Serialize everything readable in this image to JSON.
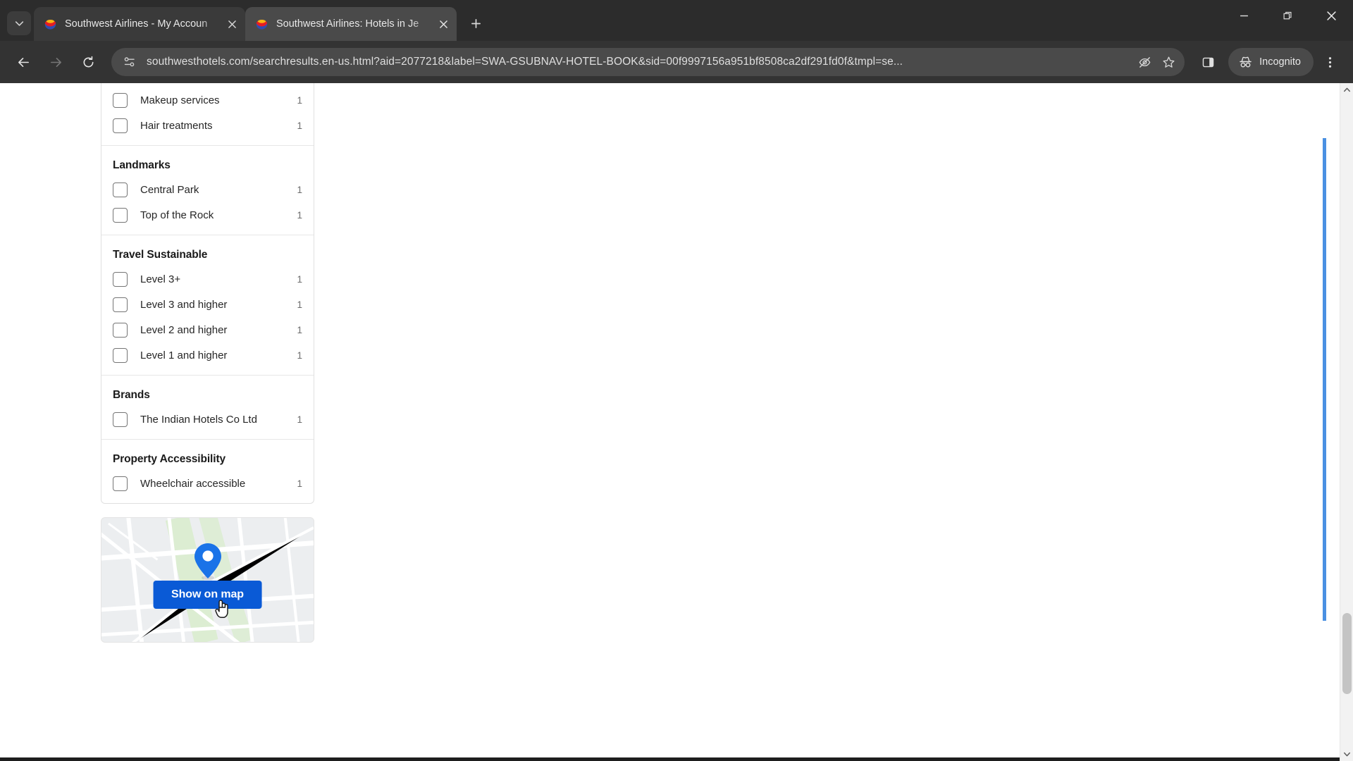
{
  "browser": {
    "tabs": [
      {
        "title": "Southwest Airlines - My Accoun",
        "active": false
      },
      {
        "title": "Southwest Airlines: Hotels in Je",
        "active": true
      }
    ],
    "new_tab_label": "+",
    "omnibox": {
      "url": "southwesthotels.com/searchresults.en-us.html?aid=2077218&label=SWA-GSUBNAV-HOTEL-BOOK&sid=00f9997156a951bf8508ca2df291fd0f&tmpl=se...",
      "site_icon": "page-info-icon",
      "tracking_protection_icon": "eye-off-icon",
      "bookmark_icon": "star-icon"
    },
    "profile": {
      "label": "Incognito",
      "icon": "incognito-icon"
    },
    "nav": {
      "back": "back-arrow-icon",
      "forward": "forward-arrow-icon",
      "reload": "reload-icon"
    },
    "side_panel_icon": "side-panel-icon",
    "menu_icon": "three-dot-menu-icon",
    "window_controls": {
      "minimize": "minimize-icon",
      "maximize": "restore-icon",
      "close": "close-icon"
    }
  },
  "sidebar": {
    "groups": [
      {
        "title": "",
        "items": [
          {
            "label": "Makeup services",
            "count": "1"
          },
          {
            "label": "Hair treatments",
            "count": "1"
          }
        ]
      },
      {
        "title": "Landmarks",
        "items": [
          {
            "label": "Central Park",
            "count": "1"
          },
          {
            "label": "Top of the Rock",
            "count": "1"
          }
        ]
      },
      {
        "title": "Travel Sustainable",
        "items": [
          {
            "label": "Level 3+",
            "count": "1"
          },
          {
            "label": "Level 3 and higher",
            "count": "1"
          },
          {
            "label": "Level 2 and higher",
            "count": "1"
          },
          {
            "label": "Level 1 and higher",
            "count": "1"
          }
        ]
      },
      {
        "title": "Brands",
        "items": [
          {
            "label": "The Indian Hotels Co Ltd",
            "count": "1"
          }
        ]
      },
      {
        "title": "Property Accessibility",
        "items": [
          {
            "label": "Wheelchair accessible",
            "count": "1"
          }
        ]
      }
    ],
    "map": {
      "button_label": "Show on map",
      "pin_icon": "map-pin-icon",
      "button_color": "#0a5ad6"
    }
  },
  "colors": {
    "accent_blue": "#0a5ad6",
    "chrome_dark": "#333333",
    "tabstrip": "#2c2c2c",
    "focus_outline": "#4a90e2"
  }
}
